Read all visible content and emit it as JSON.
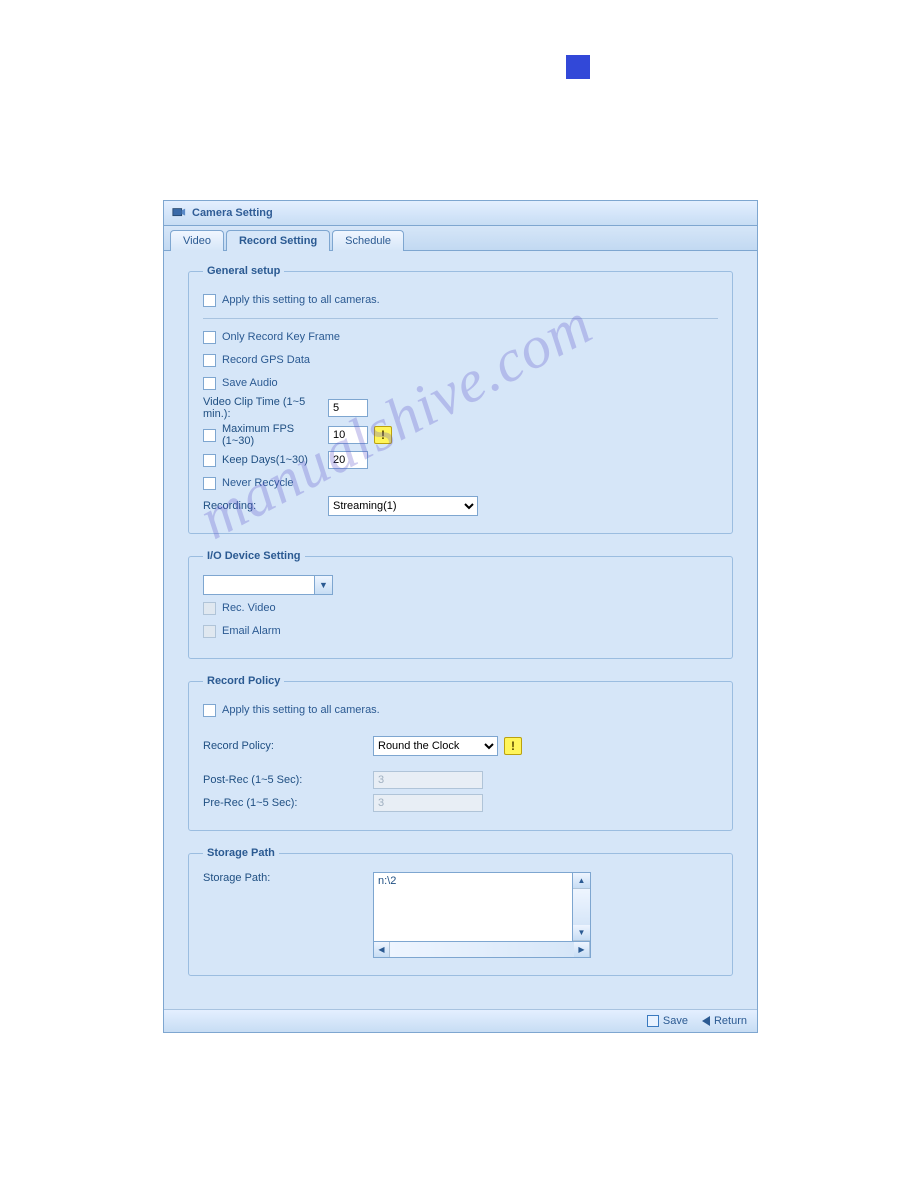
{
  "header": {
    "title": "Camera Setting"
  },
  "tabs": {
    "video": "Video",
    "record_setting": "Record Setting",
    "schedule": "Schedule"
  },
  "general_setup": {
    "legend": "General setup",
    "apply_all": "Apply this setting to all cameras.",
    "only_key_frame": "Only Record Key Frame",
    "record_gps": "Record GPS Data",
    "save_audio": "Save Audio",
    "video_clip_time_label": "Video Clip Time (1~5 min.):",
    "video_clip_time_value": "5",
    "max_fps_label": "Maximum FPS (1~30)",
    "max_fps_value": "10",
    "keep_days_label": "Keep Days(1~30)",
    "keep_days_value": "20",
    "never_recycle": "Never Recycle",
    "recording_label": "Recording:",
    "recording_value": "Streaming(1)"
  },
  "io_device": {
    "legend": "I/O Device Setting",
    "device_value": "",
    "rec_video": "Rec. Video",
    "email_alarm": "Email Alarm"
  },
  "record_policy": {
    "legend": "Record Policy",
    "apply_all": "Apply this setting to all cameras.",
    "policy_label": "Record Policy:",
    "policy_value": "Round the Clock",
    "post_rec_label": "Post-Rec (1~5 Sec):",
    "post_rec_value": "3",
    "pre_rec_label": "Pre-Rec (1~5 Sec):",
    "pre_rec_value": "3"
  },
  "storage_path": {
    "legend": "Storage Path",
    "label": "Storage Path:",
    "value": "n:\\2"
  },
  "footer": {
    "save": "Save",
    "return": "Return"
  },
  "watermark": "manualshive.com"
}
